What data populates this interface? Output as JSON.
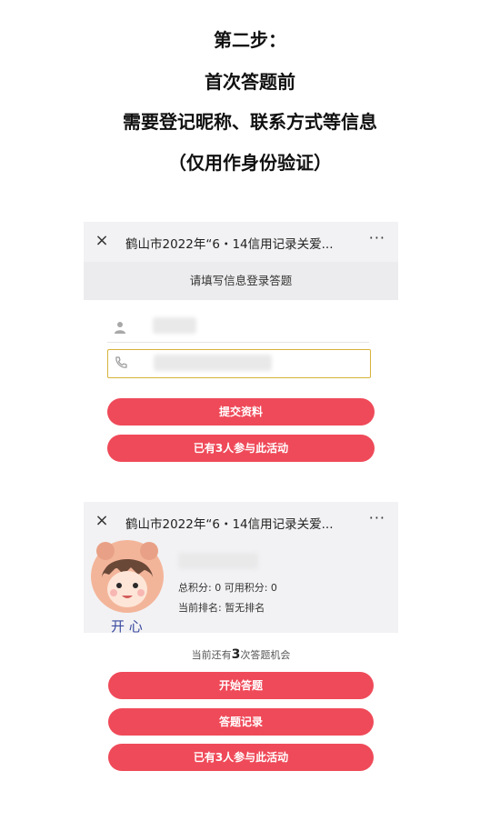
{
  "heading": {
    "line1": "第二步：",
    "line2": "首次答题前",
    "line3": "需要登记昵称、联系方式等信息",
    "line4": "（仅用作身份验证）"
  },
  "screen1": {
    "close_icon": "×",
    "title": "鹤山市2022年“6・14信用记录关爱...",
    "more_icon": "···",
    "subtitle": "请填写信息登录答题",
    "submit_label": "提交资料",
    "participants_label": "已有3人参与此活动"
  },
  "screen2": {
    "close_icon": "×",
    "title": "鹤山市2022年“6・14信用记录关爱...",
    "more_icon": "···",
    "points_text": "总积分:  0   可用积分:  0",
    "rank_text": "当前排名:   暂无排名",
    "avatar_caption": "开 心",
    "remaining_prefix": "当前还有",
    "remaining_count": "3",
    "remaining_suffix": "次答题机会",
    "start_label": "开始答题",
    "records_label": "答题记录",
    "participants_label": "已有3人参与此活动"
  },
  "colors": {
    "button": "#ef4a59",
    "input_focus_border": "#d9b23b",
    "topbar": "#f2f2f4"
  },
  "icons": [
    "close-icon",
    "more-icon",
    "user-icon",
    "phone-icon",
    "avatar-sticker"
  ]
}
